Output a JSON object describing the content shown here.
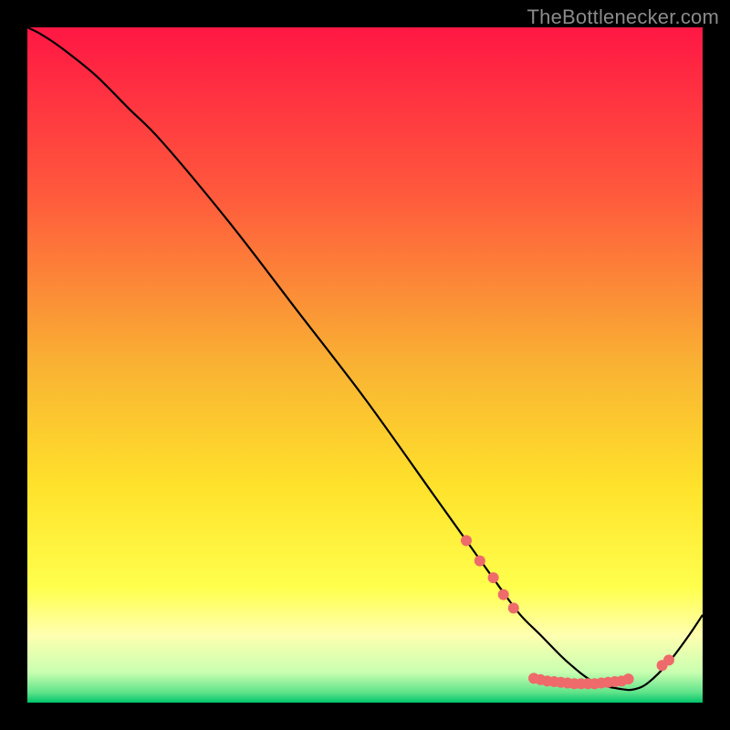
{
  "watermark": "TheBottlenecker.com",
  "chart_data": {
    "type": "line",
    "title": "",
    "xlabel": "",
    "ylabel": "",
    "xlim": [
      0,
      100
    ],
    "ylim": [
      0,
      100
    ],
    "grid": false,
    "legend": false,
    "gradient_stops": [
      {
        "offset": 0.0,
        "color": "#ff1744"
      },
      {
        "offset": 0.25,
        "color": "#ff5a3c"
      },
      {
        "offset": 0.5,
        "color": "#f9b233"
      },
      {
        "offset": 0.68,
        "color": "#ffe22b"
      },
      {
        "offset": 0.83,
        "color": "#ffff4d"
      },
      {
        "offset": 0.9,
        "color": "#ffffb0"
      },
      {
        "offset": 0.955,
        "color": "#c9ffb0"
      },
      {
        "offset": 0.985,
        "color": "#5fe38a"
      },
      {
        "offset": 1.0,
        "color": "#00c46a"
      }
    ],
    "series": [
      {
        "name": "bottleneck-curve",
        "color": "#000000",
        "x": [
          0,
          2,
          5,
          10,
          15,
          20,
          30,
          40,
          50,
          60,
          65,
          70,
          73,
          76,
          80,
          84,
          88,
          90,
          92,
          95,
          98,
          100
        ],
        "y": [
          100,
          99,
          97,
          93,
          88,
          83,
          71,
          58,
          45,
          31,
          24,
          17,
          13,
          10,
          6,
          3,
          2,
          2,
          3,
          6,
          10,
          13
        ]
      }
    ],
    "markers": {
      "name": "highlight-dots",
      "color": "#ef6a6a",
      "radius": 6,
      "points": [
        {
          "x": 65.0,
          "y": 24.0
        },
        {
          "x": 67.0,
          "y": 21.0
        },
        {
          "x": 69.0,
          "y": 18.5
        },
        {
          "x": 70.5,
          "y": 16.0
        },
        {
          "x": 72.0,
          "y": 14.0
        },
        {
          "x": 75.0,
          "y": 3.6
        },
        {
          "x": 76.0,
          "y": 3.4
        },
        {
          "x": 77.0,
          "y": 3.2
        },
        {
          "x": 78.0,
          "y": 3.1
        },
        {
          "x": 79.0,
          "y": 3.0
        },
        {
          "x": 80.0,
          "y": 2.9
        },
        {
          "x": 81.0,
          "y": 2.8
        },
        {
          "x": 82.0,
          "y": 2.8
        },
        {
          "x": 83.0,
          "y": 2.8
        },
        {
          "x": 84.0,
          "y": 2.8
        },
        {
          "x": 85.0,
          "y": 2.9
        },
        {
          "x": 86.0,
          "y": 3.0
        },
        {
          "x": 87.0,
          "y": 3.1
        },
        {
          "x": 88.0,
          "y": 3.2
        },
        {
          "x": 89.0,
          "y": 3.5
        },
        {
          "x": 94.0,
          "y": 5.5
        },
        {
          "x": 95.0,
          "y": 6.3
        }
      ]
    }
  }
}
